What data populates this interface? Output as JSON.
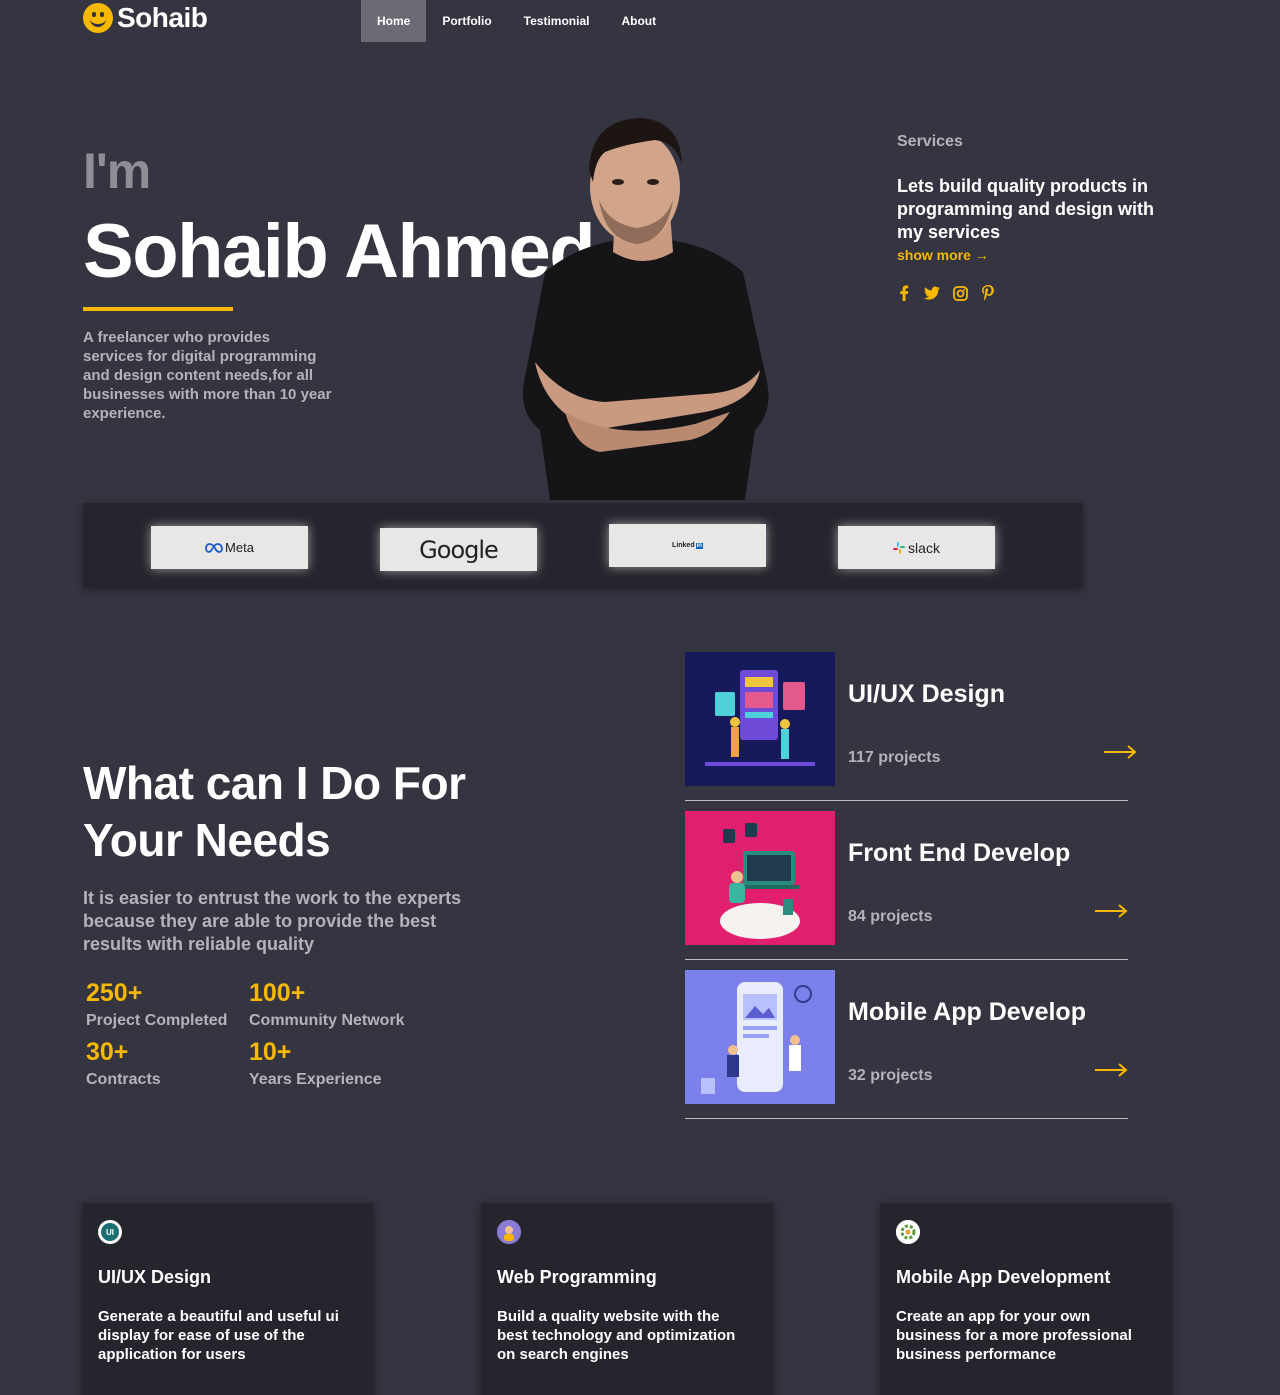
{
  "brand": {
    "name": "Sohaib"
  },
  "nav": {
    "items": [
      {
        "label": "Home",
        "active": true
      },
      {
        "label": "Portfolio",
        "active": false
      },
      {
        "label": "Testimonial",
        "active": false
      },
      {
        "label": "About",
        "active": false
      }
    ]
  },
  "hero": {
    "intro": "I'm",
    "name": "Sohaib Ahmed",
    "description": "A freelancer who provides services for digital programming and design content needs,for all businesses with more than 10 year experience."
  },
  "services_panel": {
    "label": "Services",
    "headline": "Lets build quality products in programming and design with my services",
    "more_link": "show more →",
    "socials": [
      "facebook-icon",
      "twitter-icon",
      "instagram-icon",
      "pinterest-icon"
    ]
  },
  "partners": {
    "meta": "Meta",
    "google": "Google",
    "linkedin": "Linked",
    "linkedin_in": "in",
    "slack": "slack"
  },
  "what_i_do": {
    "title": "What can I Do For Your Needs",
    "subtitle": "It is easier to entrust the work to the experts because they are able to provide the best results with reliable quality",
    "stats": [
      {
        "value": "250+",
        "label": "Project Completed"
      },
      {
        "value": "100+",
        "label": "Community Network"
      },
      {
        "value": "30+",
        "label": "Contracts"
      },
      {
        "value": "10+",
        "label": "Years Experience"
      }
    ]
  },
  "projects": [
    {
      "title": "UI/UX Design",
      "count": "117 projects"
    },
    {
      "title": "Front End Develop",
      "count": "84 projects"
    },
    {
      "title": "Mobile App Develop",
      "count": "32 projects"
    }
  ],
  "cards": [
    {
      "icon_text": "UI",
      "title": "UI/UX Design",
      "text": "Generate a beautiful and useful ui display for ease of use of the application for users"
    },
    {
      "title": "Web Programming",
      "text": "Build a quality website with the best technology and optimization on search engines"
    },
    {
      "title": "Mobile App Development",
      "text": "Create an app for your own business for a more professional business performance"
    }
  ],
  "colors": {
    "background": "#353542",
    "accent": "#f6b800",
    "panel": "#25252d"
  }
}
